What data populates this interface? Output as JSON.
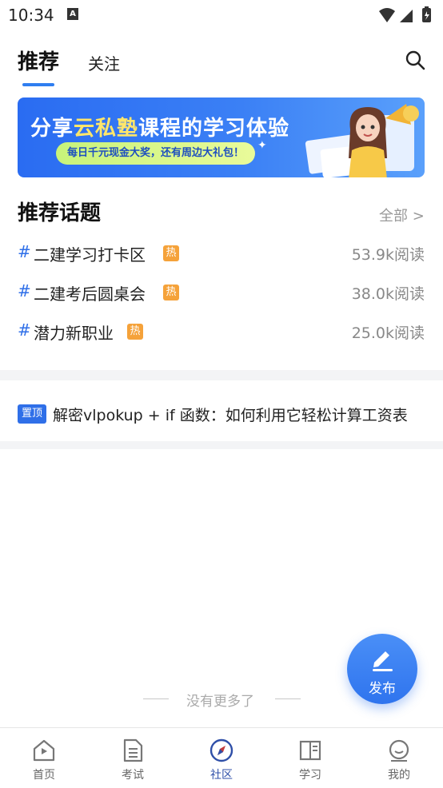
{
  "status_bar": {
    "time": "10:34",
    "sim_letter": "A"
  },
  "tabs": {
    "recommend": "推荐",
    "follow": "关注"
  },
  "banner": {
    "title_pre": "分享",
    "title_highlight": "云私塾",
    "title_post": "课程的学习体验",
    "pill": "每日千元现金大奖，还有周边大礼包！"
  },
  "topics": {
    "title": "推荐话题",
    "all_label": "全部 >",
    "hash": "#",
    "hot_label": "热",
    "items": [
      {
        "name": "二建学习打卡区",
        "reads": "53.9k阅读"
      },
      {
        "name": "二建考后圆桌会",
        "reads": "38.0k阅读"
      },
      {
        "name": "潜力新职业",
        "reads": "25.0k阅读"
      }
    ]
  },
  "pinned": {
    "badge": "置顶",
    "title": "解密vlpokup + if 函数：如何利用它轻松计算工资表"
  },
  "feed_end": "没有更多了",
  "fab": {
    "label": "发布"
  },
  "nav": {
    "items": [
      {
        "label": "首页",
        "icon": "home-icon"
      },
      {
        "label": "考试",
        "icon": "document-icon"
      },
      {
        "label": "社区",
        "icon": "compass-icon",
        "active": true
      },
      {
        "label": "学习",
        "icon": "book-icon"
      },
      {
        "label": "我的",
        "icon": "profile-icon"
      }
    ]
  },
  "colors": {
    "accent": "#2f6fe8",
    "hot": "#f5a23a",
    "nav_active": "#2f4fa8"
  }
}
